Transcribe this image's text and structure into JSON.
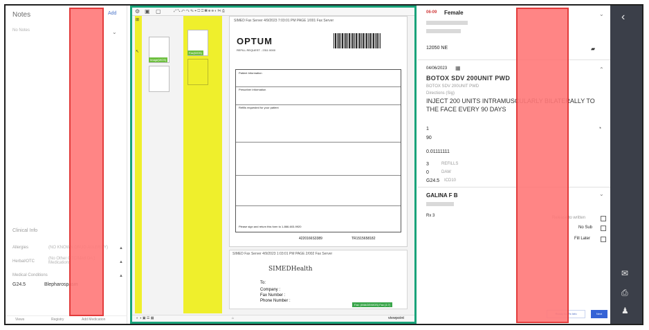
{
  "left_panel": {
    "notes_title": "Notes",
    "add_label": "Add",
    "no_notes": "No Notes",
    "clinical_info_title": "Clinical Info",
    "rows": [
      {
        "label": "Allergies",
        "value": "(NO KNOWN DRUG ALLERGY)"
      },
      {
        "label": "Herbal/OTC",
        "value": "(No Other OTC/Med On.) Medications"
      },
      {
        "label": "Medical Conditions",
        "value": ""
      }
    ],
    "condition_code": "G24.5",
    "condition_name": "Blepharospasm",
    "footer": [
      "Views",
      "Registry",
      "Add Medication"
    ]
  },
  "viewer": {
    "top_line": "SIMED Fax Server  4/9/2023 7:03:01 PM  PAGE 1/001  Fax Server",
    "logo": "OPTUM",
    "refill_title": "REFILL REQUEST - 2311 0000",
    "thumb_tags": [
      "Image(WOS)",
      "Fax(WOS)"
    ],
    "form_sections": [
      "Patient Information",
      "Prescriber Information",
      "Refills requested for your patient",
      "Please sign and return this form to 1-866-603-9920"
    ],
    "numbers_left": "4220166S3389",
    "numbers_right": "TR1515658182",
    "page2_line": "SIMED Fax Server  4/9/2023 1:03:01 PM  PAGE 2/002  Fax Server",
    "simed_logo": "SIMEDHealth",
    "to_label": "To:",
    "company_label": "Company :",
    "fax_label": "Fax Number :",
    "phone_label": "Phone Number :",
    "green_badge": "Fax: (IMAGE/WOS) Fax (1:7)",
    "brand": "viewpoint"
  },
  "right_panel": {
    "gender": "Female",
    "id_prefix": "06-09",
    "addr": "12050 NE",
    "date": "04/06/2023",
    "drug_name": "BOTOX SDV 200UNIT PWD",
    "drug_sub": "BOTOX SDV 200UNIT PWD",
    "directions_label": "Directions (Sig)",
    "sig": "INJECT 200 UNITS INTRAMUSCULARLY BILATERALLY TO THE FACE EVERY 90 DAYS",
    "qty1": "1",
    "days": "90",
    "ndc": "0.01111111",
    "refills": "3",
    "refills_label": "REFILLS",
    "daw": "0",
    "daw_label": "DAW",
    "dx": "G24.5",
    "dx_label": "ICD10",
    "prescriber": "GALINA F B",
    "rx_no": "Rx 3",
    "check_labels": [
      "Release to written",
      "No Sub",
      "Fill Later"
    ],
    "btn_ready": "Ready for Rx Info",
    "btn_next": "Next"
  },
  "colors": {
    "viewer_border": "#19a37a",
    "redaction": "#ff7878",
    "highlight": "#efef2c",
    "rail": "#3b3f49",
    "primary": "#3563d6"
  }
}
